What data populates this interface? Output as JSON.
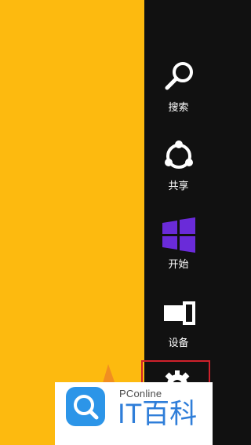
{
  "charms": {
    "search": {
      "label": "搜索",
      "icon": "search-icon"
    },
    "share": {
      "label": "共享",
      "icon": "share-icon"
    },
    "start": {
      "label": "开始",
      "icon": "windows-start-icon"
    },
    "devices": {
      "label": "设备",
      "icon": "devices-icon"
    },
    "settings": {
      "icon": "gear-icon"
    }
  },
  "watermark": {
    "brand_small": "PConline",
    "brand_large": "IT百科"
  },
  "colors": {
    "desktop_bg": "#fdba0f",
    "charms_bg": "#111111",
    "start_icon": "#6a2bd9",
    "highlight": "#d0212b",
    "logo_blue": "#2c95e8"
  }
}
